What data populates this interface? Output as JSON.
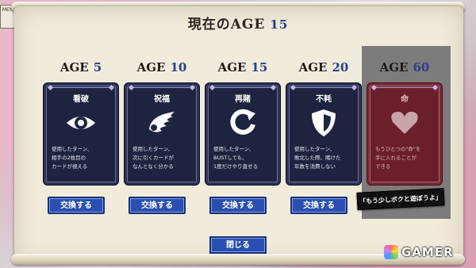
{
  "menu_label": "MEN",
  "title": {
    "label": "現在のAGE",
    "value": "15"
  },
  "cards": [
    {
      "age_label": "AGE",
      "age_value": "5",
      "name": "看破",
      "icon": "eye-icon",
      "desc": [
        "使用したターン、",
        "相手の2枚目の",
        "カードが視える"
      ],
      "button": "交換する"
    },
    {
      "age_label": "AGE",
      "age_value": "10",
      "name": "祝福",
      "icon": "wing-icon",
      "desc": [
        "使用したターン、",
        "次に引くカードが",
        "なんとなく分かる"
      ],
      "button": "交換する"
    },
    {
      "age_label": "AGE",
      "age_value": "15",
      "name": "再賭",
      "icon": "refresh-icon",
      "desc": [
        "使用したターン、",
        "BUSTしても、",
        "1度だけやり直せる"
      ],
      "button": "交換する"
    },
    {
      "age_label": "AGE",
      "age_value": "20",
      "name": "不耗",
      "icon": "shield-icon",
      "desc": [
        "使用したターン、",
        "敗北した際、賭けた",
        "年数を消費しない"
      ],
      "button": "交換する"
    },
    {
      "age_label": "AGE",
      "age_value": "60",
      "name": "命",
      "icon": "heart-icon",
      "desc": [
        "もうひとつの\"命\"を",
        "手に入れることが",
        "できる"
      ]
    }
  ],
  "speech": "「もう少しボクと遊ぼうよ」",
  "close_button": "閉じる",
  "logo": "GAMER",
  "colors": {
    "card_blue": "#1e2340",
    "card_red": "#6a1f2b",
    "button_blue": "#2a4fb0",
    "accent_age": "#263c8a"
  }
}
